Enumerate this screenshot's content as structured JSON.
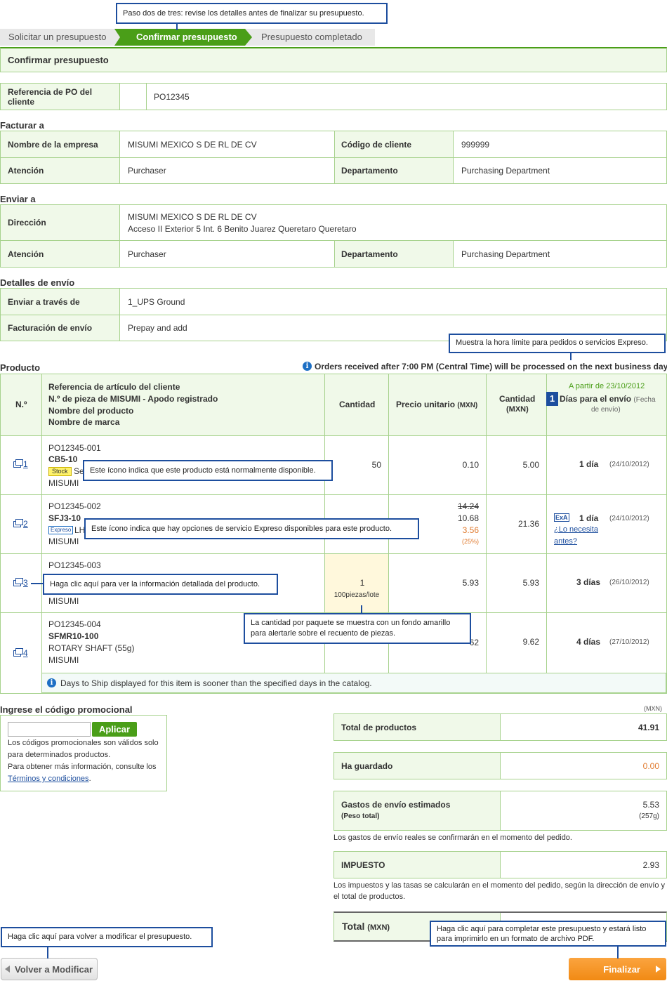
{
  "tooltips": {
    "step": "Paso dos de tres: revise los detalles antes de finalizar su presupuesto.",
    "express_cutoff": "Muestra la hora límite para pedidos o servicios Expreso.",
    "stock": "Este ícono indica que este producto está normalmente disponible.",
    "express": "Este ícono indica que hay opciones de servicio Expreso disponibles para este producto.",
    "detail": "Haga clic aquí para ver la información detallada del producto.",
    "lot_line1": "La cantidad por paquete se muestra con un fondo amarillo",
    "lot_line2": "para alertarle sobre el recuento de piezas.",
    "modify": "Haga clic aquí para volver a modificar el presupuesto.",
    "finalize_line1": "Haga clic aquí para completar este presupuesto y estará listo",
    "finalize_line2": "para imprimirlo en un formato de archivo PDF."
  },
  "steps": [
    "Solicitar un presupuesto",
    "Confirmar presupuesto",
    "Presupuesto completado"
  ],
  "page_title": "Confirmar presupuesto",
  "po": {
    "label": "Referencia de PO del cliente",
    "value": "PO12345"
  },
  "bill": {
    "title": "Facturar a",
    "company_label": "Nombre de la empresa",
    "company": "MISUMI MEXICO S DE RL DE CV",
    "code_label": "Código de cliente",
    "code": "999999",
    "attn_label": "Atención",
    "attn": "Purchaser",
    "dept_label": "Departamento",
    "dept": "Purchasing Department"
  },
  "ship": {
    "title": "Enviar a",
    "addr_label": "Dirección",
    "addr1": "MISUMI MEXICO S DE RL DE CV",
    "addr2": "Acceso II Exterior 5 Int. 6 Benito Juarez Queretaro Queretaro",
    "attn_label": "Atención",
    "attn": "Purchaser",
    "dept_label": "Departamento",
    "dept": "Purchasing Department"
  },
  "shipping": {
    "title": "Detalles de envío",
    "via_label": "Enviar a través de",
    "via": "1_UPS Ground",
    "billing_label": "Facturación de envío",
    "billing": "Prepay and add"
  },
  "product": {
    "title": "Producto",
    "notice": "Orders received after 7:00 PM (Central Time) will be processed on the next business day.",
    "headers": {
      "no": "N.º",
      "ref1": "Referencia de artículo del cliente",
      "ref2": "N.º de pieza de MISUMI - Apodo registrado",
      "ref3": "Nombre del producto",
      "ref4": "Nombre de marca",
      "qty": "Cantidad",
      "unit": "Precio unitario",
      "unit_cur": "(MXN)",
      "amount": "Cantidad",
      "amount_cur": "(MXN)",
      "date_note": "A partir de 23/10/2012",
      "badge": "1",
      "days": "Días para el envío",
      "days_sub1": "(Fecha",
      "days_sub2": "de envío)"
    },
    "rows": [
      {
        "no": "1",
        "ref": "PO12345-001",
        "part": "CB5-10",
        "badge": "Stock",
        "name": "Se",
        "brand": "MISUMI",
        "qty": "50",
        "unit": "0.10",
        "amount": "5.00",
        "days": "1 día",
        "date": "(24/10/2012)"
      },
      {
        "no": "2",
        "ref": "PO12345-002",
        "part": "SFJ3-10",
        "badge": "Expreso",
        "name": "LH",
        "brand": "MISUMI",
        "list": "14.24",
        "unit": "10.68",
        "disc": "3.56",
        "pct": "(25%)",
        "amount": "21.36",
        "exp": "ExA",
        "days": "1 día",
        "date": "(24/10/2012)",
        "need1": "¿Lo necesita",
        "need2": "antes?"
      },
      {
        "no": "3",
        "ref": "PO12345-003",
        "brand": "MISUMI",
        "qty": "1",
        "lot": "100piezas/lote",
        "unit": "5.93",
        "amount": "5.93",
        "days": "3 días",
        "date": "(26/10/2012)"
      },
      {
        "no": "4",
        "ref": "PO12345-004",
        "part": "SFMR10-100",
        "name": "ROTARY SHAFT (55g)",
        "brand": "MISUMI",
        "unit": "62",
        "amount": "9.62",
        "days": "4 días",
        "date": "(27/10/2012)"
      }
    ],
    "footnote": "Days to Ship displayed for this item is sooner than the specified days in the catalog."
  },
  "promo": {
    "title": "Ingrese el código promocional",
    "button": "Aplicar",
    "text1": "Los códigos promocionales son válidos solo",
    "text2": "para determinados productos.",
    "text3": "Para obtener más información, consulte los",
    "link": "Términos y condiciones",
    "after": "."
  },
  "totals": {
    "currency": "(MXN)",
    "products_label": "Total de productos",
    "products": "41.91",
    "saved_label": "Ha guardado",
    "saved": "0.00",
    "shipping_label": "Gastos de envío estimados",
    "weight_label": "(Peso total)",
    "shipping": "5.53",
    "weight": "(257g)",
    "shipping_note": "Los gastos de envío reales se confirmarán en el momento del pedido.",
    "tax_label": "IMPUESTO",
    "tax": "2.93",
    "tax_note1": "Los impuestos y las tasas se calcularán en el momento del pedido, según la dirección de envío y",
    "tax_note2": "el total de productos.",
    "total_label": "Total",
    "total_cur": "(MXN)"
  },
  "buttons": {
    "back": "Volver a Modificar",
    "finalize": "Finalizar"
  },
  "colors": {
    "accent": "#4a9e18",
    "border": "#a7d28d",
    "label_bg": "#f0f9e9",
    "callout": "#1d4e9e",
    "orange": "#f7931e",
    "discount": "#e07a2e"
  }
}
